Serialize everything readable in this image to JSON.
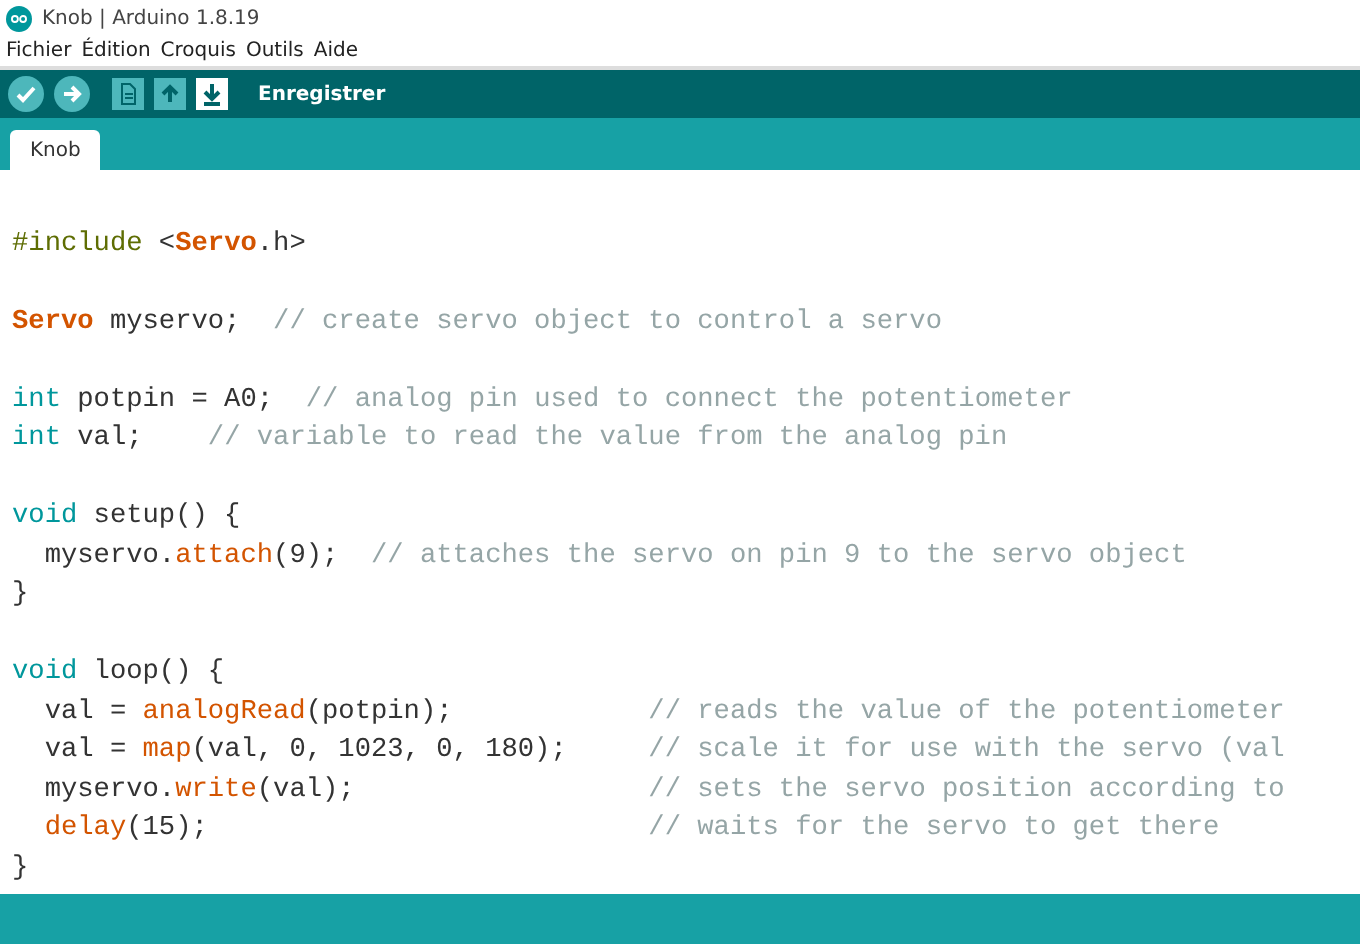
{
  "window": {
    "title": "Knob | Arduino 1.8.19"
  },
  "menu": [
    "Fichier",
    "Édition",
    "Croquis",
    "Outils",
    "Aide"
  ],
  "toolbar": {
    "buttons": [
      {
        "kind": "verify",
        "highlighted": false
      },
      {
        "kind": "upload",
        "highlighted": false
      },
      {
        "kind": "new",
        "highlighted": false
      },
      {
        "kind": "open",
        "highlighted": false
      },
      {
        "kind": "save",
        "highlighted": true
      }
    ],
    "hint": "Enregistrer"
  },
  "tabs": [
    {
      "label": "Knob",
      "selected": true
    }
  ],
  "code": [
    {
      "kind": "blank"
    },
    {
      "kind": "code",
      "tokens": [
        {
          "kind": "preproc",
          "text": "#include "
        },
        {
          "kind": "plain",
          "text": "<"
        },
        {
          "kind": "keyword",
          "text": "Servo"
        },
        {
          "kind": "plain",
          "text": ".h>"
        }
      ]
    },
    {
      "kind": "blank"
    },
    {
      "kind": "code",
      "tokens": [
        {
          "kind": "keyword",
          "text": "Servo"
        },
        {
          "kind": "plain",
          "text": " myservo;  "
        },
        {
          "kind": "comment",
          "text": "// create servo object to control a servo"
        }
      ]
    },
    {
      "kind": "blank"
    },
    {
      "kind": "code",
      "tokens": [
        {
          "kind": "type",
          "text": "int"
        },
        {
          "kind": "plain",
          "text": " potpin = A0;  "
        },
        {
          "kind": "comment",
          "text": "// analog pin used to connect the potentiometer"
        }
      ]
    },
    {
      "kind": "code",
      "tokens": [
        {
          "kind": "type",
          "text": "int"
        },
        {
          "kind": "plain",
          "text": " val;    "
        },
        {
          "kind": "comment",
          "text": "// variable to read the value from the analog pin"
        }
      ]
    },
    {
      "kind": "blank"
    },
    {
      "kind": "code",
      "tokens": [
        {
          "kind": "type",
          "text": "void"
        },
        {
          "kind": "plain",
          "text": " setup() {"
        }
      ]
    },
    {
      "kind": "code",
      "tokens": [
        {
          "kind": "plain",
          "text": "  myservo."
        },
        {
          "kind": "function",
          "text": "attach"
        },
        {
          "kind": "plain",
          "text": "(9);  "
        },
        {
          "kind": "comment",
          "text": "// attaches the servo on pin 9 to the servo object"
        }
      ]
    },
    {
      "kind": "code",
      "tokens": [
        {
          "kind": "plain",
          "text": "}"
        }
      ]
    },
    {
      "kind": "blank"
    },
    {
      "kind": "code",
      "tokens": [
        {
          "kind": "type",
          "text": "void"
        },
        {
          "kind": "plain",
          "text": " loop() {"
        }
      ]
    },
    {
      "kind": "code",
      "tokens": [
        {
          "kind": "plain",
          "text": "  val = "
        },
        {
          "kind": "function",
          "text": "analogRead"
        },
        {
          "kind": "plain",
          "text": "(potpin);            "
        },
        {
          "kind": "comment",
          "text": "// reads the value of the potentiometer"
        }
      ]
    },
    {
      "kind": "code",
      "tokens": [
        {
          "kind": "plain",
          "text": "  val = "
        },
        {
          "kind": "function",
          "text": "map"
        },
        {
          "kind": "plain",
          "text": "(val, 0, 1023, 0, 180);     "
        },
        {
          "kind": "comment",
          "text": "// scale it for use with the servo (val"
        }
      ]
    },
    {
      "kind": "code",
      "tokens": [
        {
          "kind": "plain",
          "text": "  myservo."
        },
        {
          "kind": "function",
          "text": "write"
        },
        {
          "kind": "plain",
          "text": "(val);                  "
        },
        {
          "kind": "comment",
          "text": "// sets the servo position according to"
        }
      ]
    },
    {
      "kind": "code",
      "tokens": [
        {
          "kind": "function",
          "text": "  delay"
        },
        {
          "kind": "plain",
          "text": "(15);                           "
        },
        {
          "kind": "comment",
          "text": "// waits for the servo to get there"
        }
      ]
    },
    {
      "kind": "code",
      "tokens": [
        {
          "kind": "plain",
          "text": "}"
        }
      ]
    }
  ]
}
